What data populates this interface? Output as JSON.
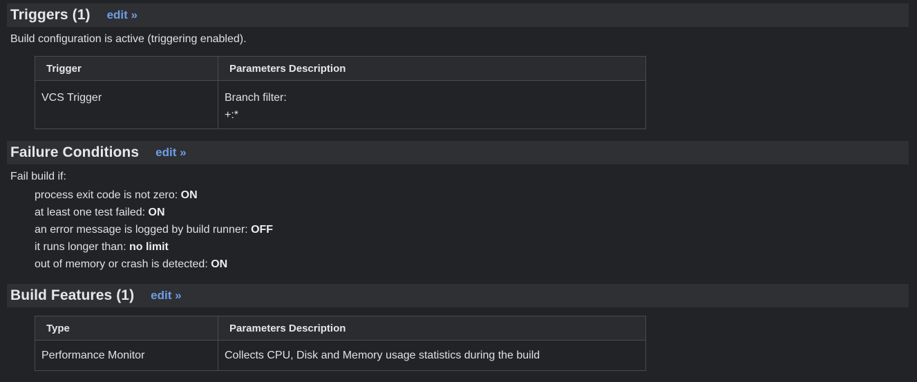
{
  "triggers": {
    "title": "Triggers (1)",
    "edit": "edit »",
    "status": "Build configuration is active (triggering enabled).",
    "columns": [
      "Trigger",
      "Parameters Description"
    ],
    "rows": [
      {
        "name": "VCS Trigger",
        "desc_line1": "Branch filter:",
        "desc_line2": "+:*"
      }
    ]
  },
  "failure": {
    "title": "Failure Conditions",
    "edit": "edit »",
    "intro": "Fail build if:",
    "conditions": [
      {
        "label": "process exit code is not zero: ",
        "value": "ON"
      },
      {
        "label": "at least one test failed: ",
        "value": "ON"
      },
      {
        "label": "an error message is logged by build runner: ",
        "value": "OFF"
      },
      {
        "label": "it runs longer than: ",
        "value": "no limit"
      },
      {
        "label": "out of memory or crash is detected: ",
        "value": "ON"
      }
    ]
  },
  "features": {
    "title": "Build Features (1)",
    "edit": "edit »",
    "columns": [
      "Type",
      "Parameters Description"
    ],
    "rows": [
      {
        "name": "Performance Monitor",
        "desc": "Collects CPU, Disk and Memory usage statistics during the build"
      }
    ]
  }
}
